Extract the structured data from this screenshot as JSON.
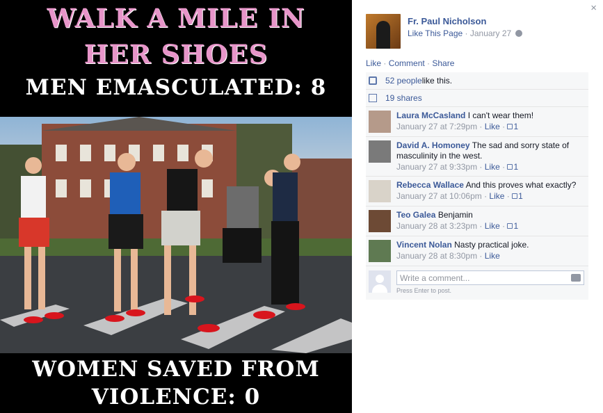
{
  "photo": {
    "top_line1": "WALK A MILE IN",
    "top_line2": "HER SHOES",
    "middle_line": "MEN EMASCULATED: 8",
    "bottom_line1": "WOMEN SAVED FROM",
    "bottom_line2": "VIOLENCE: 0"
  },
  "close_icon": "×",
  "post": {
    "author": "Fr. Paul Nicholson",
    "like_page": "Like This Page",
    "separator": "·",
    "date": "January 27"
  },
  "actions": {
    "like": "Like",
    "comment": "Comment",
    "share": "Share",
    "sep": " · "
  },
  "likes": {
    "people": "52 people",
    "suffix": " like this."
  },
  "shares": {
    "label": "19 shares"
  },
  "comments": [
    {
      "name": "Laura McCasland",
      "text": "I can't wear them!",
      "time": "January 27 at 7:29pm",
      "like": "Like",
      "count": "1",
      "avatar_color": "#b59a8a"
    },
    {
      "name": "David A. Homoney",
      "text": "The sad and sorry state of masculinity in the west.",
      "time": "January 27 at 9:33pm",
      "like": "Like",
      "count": "1",
      "avatar_color": "#7a7a7a"
    },
    {
      "name": "Rebecca Wallace",
      "text": "And this proves what exactly?",
      "time": "January 27 at 10:06pm",
      "like": "Like",
      "count": "1",
      "avatar_color": "#d9d3c9"
    },
    {
      "name": "Teo Galea",
      "text": "Benjamin",
      "time": "January 28 at 3:23pm",
      "like": "Like",
      "count": "1",
      "avatar_color": "#6d4a35"
    },
    {
      "name": "Vincent Nolan",
      "text": "Nasty practical joke.",
      "time": "January 28 at 8:30pm",
      "like": "Like",
      "count": "",
      "avatar_color": "#5f7a52"
    }
  ],
  "composer": {
    "placeholder": "Write a comment...",
    "hint": "Press Enter to post."
  }
}
